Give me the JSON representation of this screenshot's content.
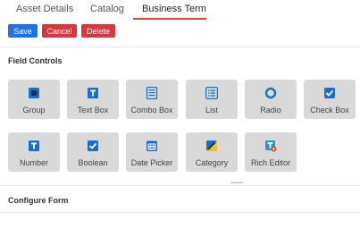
{
  "tabs": [
    {
      "label": "Asset Details"
    },
    {
      "label": "Catalog"
    },
    {
      "label": "Business Term",
      "active": true
    }
  ],
  "actions": {
    "save": "Save",
    "cancel": "Cancel",
    "delete": "Delete"
  },
  "field_controls": {
    "title": "Field Controls",
    "items": [
      {
        "label": "Group",
        "icon": "tag-icon"
      },
      {
        "label": "Text Box",
        "icon": "text-box-icon"
      },
      {
        "label": "Combo Box",
        "icon": "combo-box-icon"
      },
      {
        "label": "List",
        "icon": "list-icon"
      },
      {
        "label": "Radio",
        "icon": "radio-icon"
      },
      {
        "label": "Check Box",
        "icon": "check-box-icon"
      },
      {
        "label": "Number",
        "icon": "number-icon"
      },
      {
        "label": "Boolean",
        "icon": "boolean-icon"
      },
      {
        "label": "Date Picker",
        "icon": "calendar-icon"
      },
      {
        "label": "Category",
        "icon": "category-icon"
      },
      {
        "label": "Rich Editor",
        "icon": "rich-editor-icon"
      }
    ]
  },
  "configure_form": {
    "title": "Configure Form"
  },
  "colors": {
    "primary": "#1a73e8",
    "danger": "#d9363e",
    "tab_underline": "#e0442b",
    "control_bg": "#d9d9d9",
    "icon_blue": "#1a6fc9",
    "category_yellow": "#f2c12e",
    "rich_editor_red": "#e04a2b"
  }
}
